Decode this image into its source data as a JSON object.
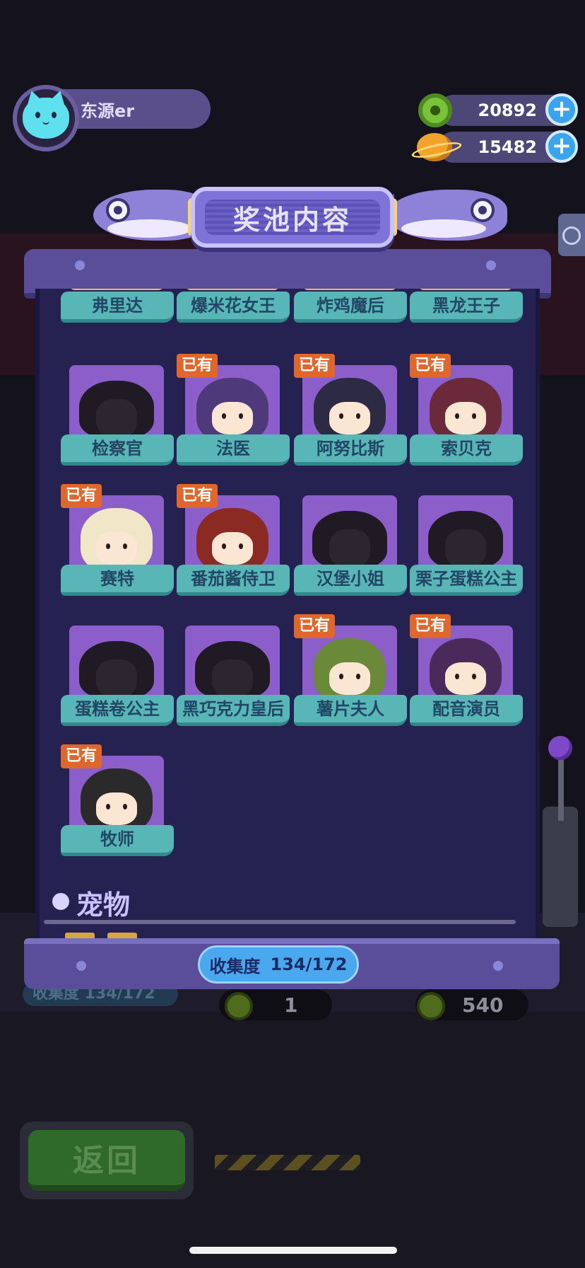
{
  "hud": {
    "username": "东源er",
    "currencies": [
      {
        "name": "donut-coin",
        "value": "20892"
      },
      {
        "name": "planet-coin",
        "value": "15482"
      }
    ],
    "plus": "+"
  },
  "dialog": {
    "title": "奖池内容",
    "collection_label": "收集度",
    "collection_value": "134/172",
    "owned_badge": "已有",
    "section_pets": "宠物"
  },
  "characters_partial": [
    {
      "name": "弗里达"
    },
    {
      "name": "爆米花女王"
    },
    {
      "name": "炸鸡魔后"
    },
    {
      "name": "黑龙王子"
    }
  ],
  "characters": [
    {
      "name": "检察官",
      "owned": false
    },
    {
      "name": "法医",
      "owned": true,
      "color": "#4e3a7a"
    },
    {
      "name": "阿努比斯",
      "owned": true,
      "color": "#2d2a44"
    },
    {
      "name": "索贝克",
      "owned": true,
      "color": "#6a2a3a"
    },
    {
      "name": "赛特",
      "owned": true,
      "color": "#f2e6c8"
    },
    {
      "name": "番茄酱侍卫",
      "owned": true,
      "color": "#8a2a22"
    },
    {
      "name": "汉堡小姐",
      "owned": false
    },
    {
      "name": "栗子蛋糕公主",
      "owned": false
    },
    {
      "name": "蛋糕卷公主",
      "owned": false
    },
    {
      "name": "黑巧克力皇后",
      "owned": false
    },
    {
      "name": "薯片夫人",
      "owned": true,
      "color": "#6a8a3a"
    },
    {
      "name": "配音演员",
      "owned": true,
      "color": "#4a2a5a"
    },
    {
      "name": "牧师",
      "owned": true,
      "color": "#2a2a2a"
    }
  ],
  "background": {
    "stat_text": "收集度  134/172",
    "coin_values": [
      "1",
      "540"
    ],
    "back_label": "返回"
  }
}
